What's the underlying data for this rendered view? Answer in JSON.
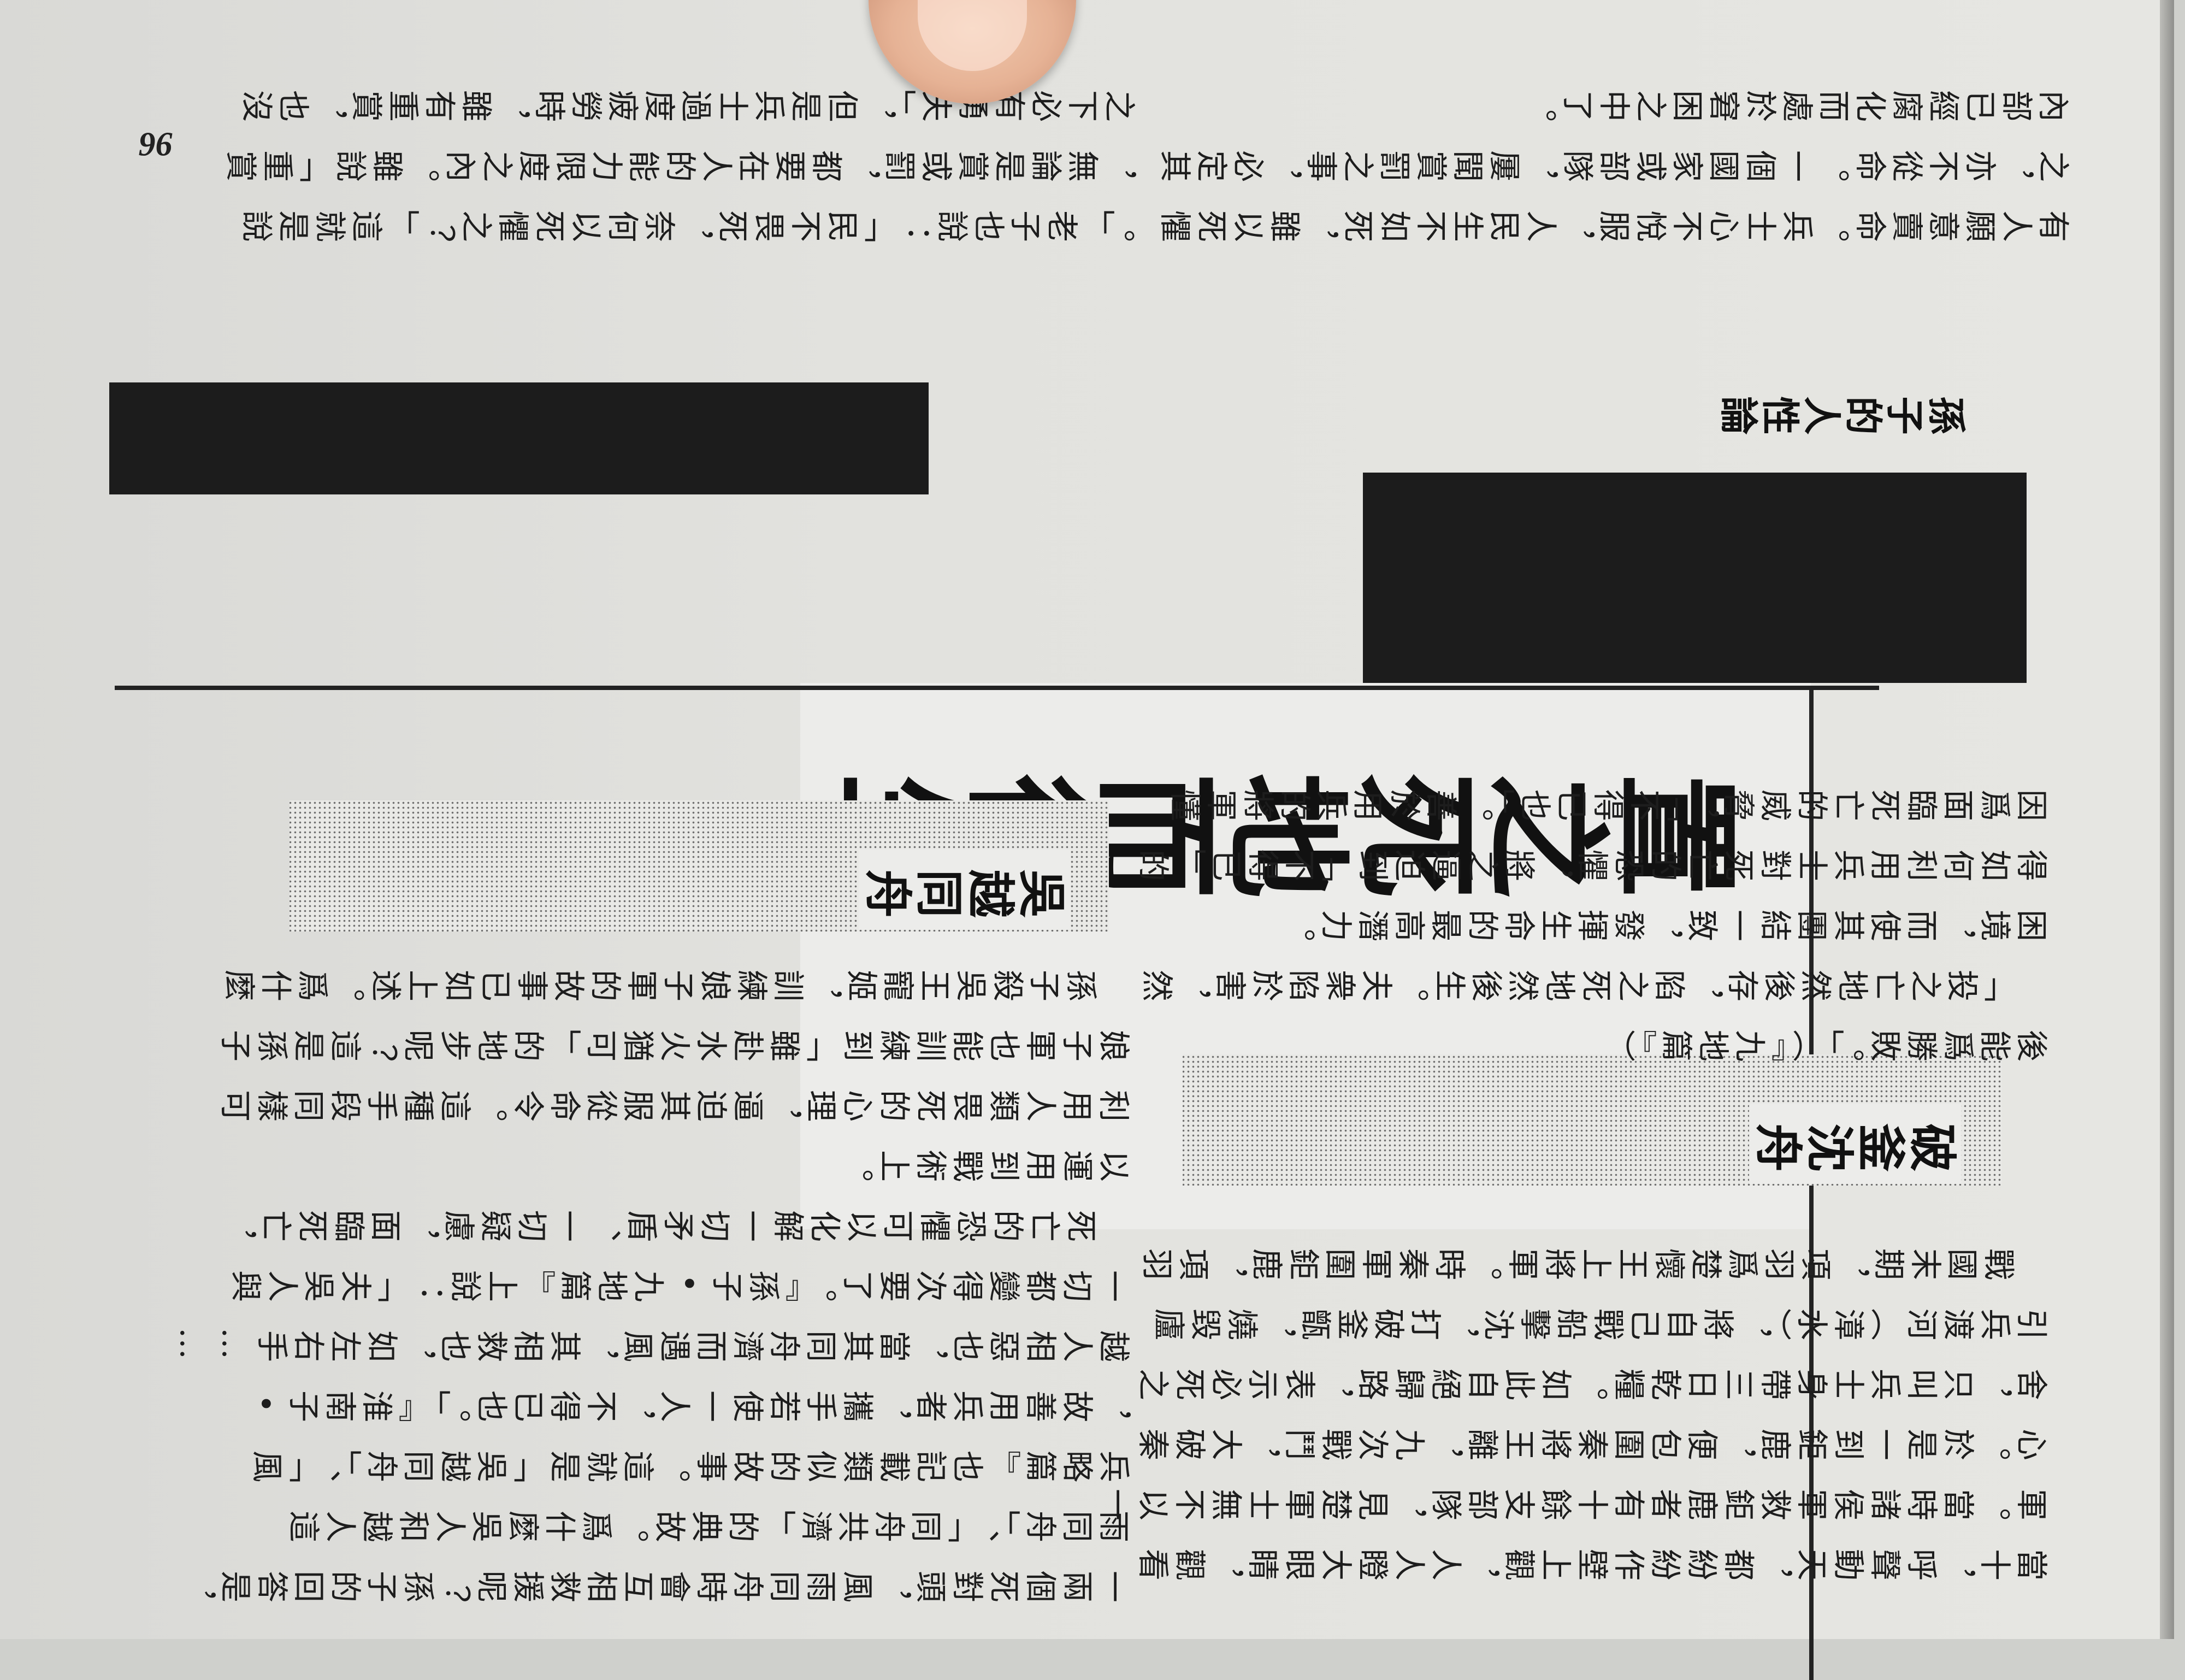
{
  "page_number": "96",
  "running_head": "孫子的人性論",
  "chapter_title": "置之死地而後生",
  "top_text": {
    "right_column": [
      "有人願意賣命。兵士心不悅服，人民生不如死，雖以死懼",
      "之，亦不從命。一個國家或部隊，屢聞賞罰之事，必定其",
      "內部已經腐化而處於窘困之中了。"
    ],
    "left_column": [
      "。」老子也說：「民不畏死，奈何以死懼之？」這就是說",
      "，無論是賞或罰，都要在人的能力限度之內。雖說「重賞",
      "之下必有勇夫」，但是兵士過度疲勞時，雖有重賞，也沒"
    ]
  },
  "section_wuyue": {
    "heading": "吳越同舟",
    "paragraphs": [
      [
        "孫子殺吳王寵姬，訓練娘子軍的故事已如上述。爲什麼",
        "娘子軍也能訓練到「雖赴水火猶可」的地步呢？這是孫子",
        "利用人類畏死的心理，逼迫其服從命令。這種手段同樣可",
        "以運用到戰術上。"
      ],
      [
        "死亡的恐懼可以化解一切矛盾、一切疑慮，面臨死亡，",
        "一切都變得次要了。『孫子•九地篇』上說：「夫吳人與",
        "越人相惡也，當其同舟濟而遇風，其相救也，如左右手……",
        "，故善用兵者，攜手若使一人，不得已也。」『淮南子•",
        "兵略篇』也記載類似的故事。這就是「吳越同舟」、「風",
        "雨同舟」、「同舟共濟」的典故。爲什麼吳人和越人這",
        "一兩個死對頭，風雨同舟時會互相救援呢？孫子的回答是，"
      ]
    ]
  },
  "right_lower_text": {
    "paragraphs": [
      [
        "因爲面臨死亡的威脅，「不得已也」。善於用兵的將軍懂",
        "得如何利用兵士對死亡的恐懼，將之逼迫到「不得已」的",
        "困境，而使其團結一致，發揮生命的最高潛力。"
      ],
      [
        "「投之亡地然後存，陷之死地然後生。夫衆陷於害，然",
        "後能爲勝敗。」（『九地篇』）"
      ]
    ]
  },
  "section_pofu": {
    "heading": "破釜沈舟",
    "paragraphs": [
      [
        "戰國末期，項羽爲楚懷王上將軍。時秦軍圍鉅鹿，項羽",
        "引兵渡河（漳水），將自己戰船擊沈，打破釜甑，燒毀廬",
        "舍，只叫兵士身帶三日乾糧。如此自絕歸路，表示必死之",
        "心。於是一到鉅鹿，便包圍秦將王離，九次戰鬥，大破秦",
        "軍。當時諸侯軍救鉅鹿者有十餘支部隊，見楚軍士無不以一",
        "當十，呼聲動天，都紛紛作壁上觀，人人瞪大眼睛，觀看"
      ]
    ]
  }
}
